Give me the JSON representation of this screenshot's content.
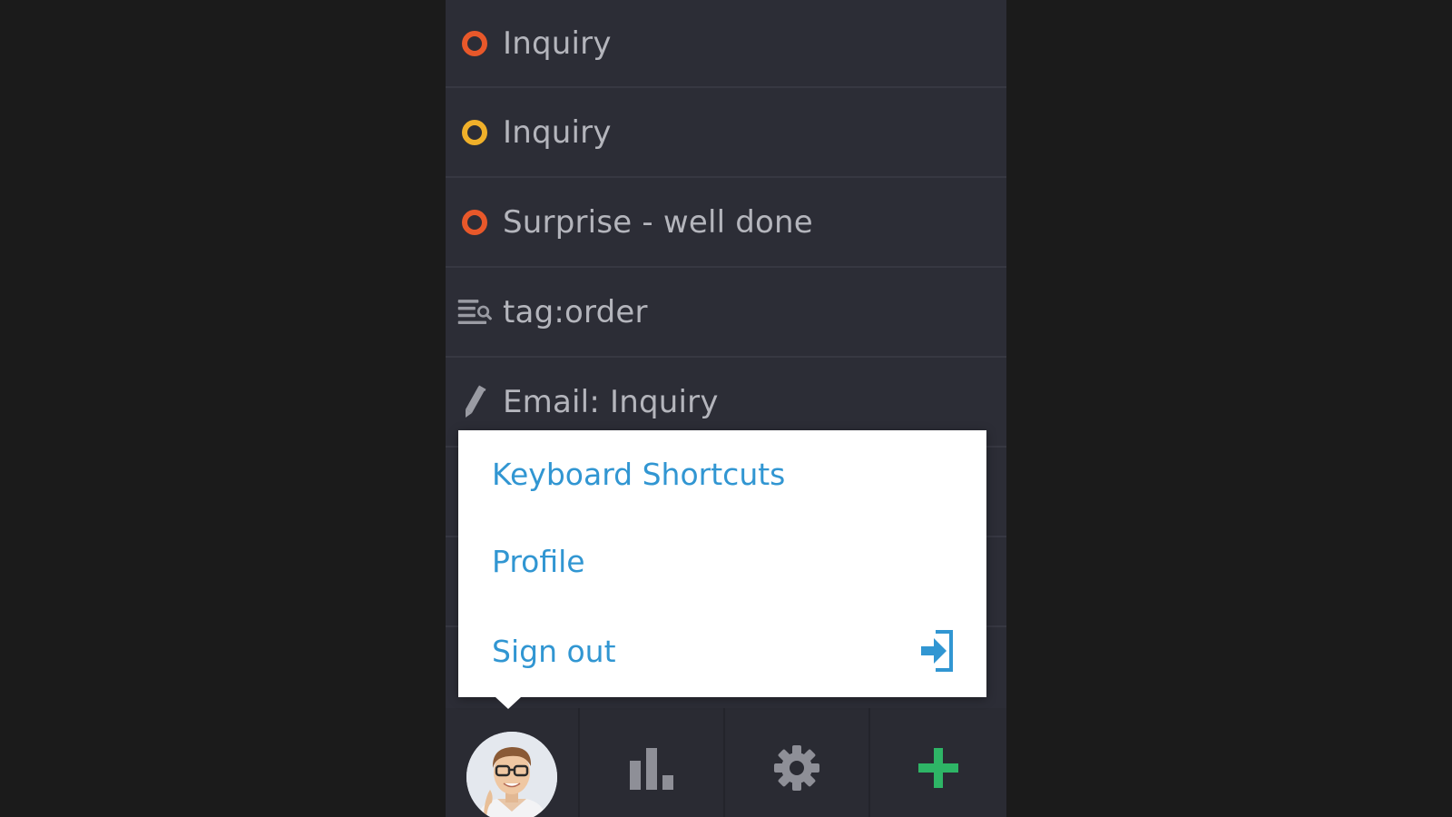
{
  "list": {
    "items": [
      {
        "label": "Inquiry",
        "icon": "orange-ring-icon",
        "color": "#e8582a"
      },
      {
        "label": "Inquiry",
        "icon": "yellow-ring-icon",
        "color": "#f0b02a"
      },
      {
        "label": "Surprise - well done",
        "icon": "orange-ring-icon",
        "color": "#e8582a"
      },
      {
        "label": "tag:order",
        "icon": "search-list-icon"
      },
      {
        "label": "Email: Inquiry",
        "icon": "pencil-icon"
      },
      {
        "label": "",
        "icon": "orange-ring-icon",
        "color": "#e8582a"
      },
      {
        "label": "",
        "icon": ""
      }
    ]
  },
  "popup_menu": {
    "items": [
      {
        "label": "Keyboard Shortcuts"
      },
      {
        "label": "Profile"
      },
      {
        "label": "Sign out",
        "icon": "sign-out-icon"
      }
    ],
    "color": "#3196d2"
  },
  "bottom_bar": {
    "tabs": [
      {
        "name": "user-avatar",
        "icon": "avatar"
      },
      {
        "name": "statistics",
        "icon": "bar-chart-icon"
      },
      {
        "name": "settings",
        "icon": "gear-icon"
      },
      {
        "name": "new",
        "icon": "plus-icon",
        "color": "#2eb566"
      }
    ]
  },
  "colors": {
    "background": "#1b1b1b",
    "panel": "#2c2d36",
    "text": "#b4b5bc"
  }
}
